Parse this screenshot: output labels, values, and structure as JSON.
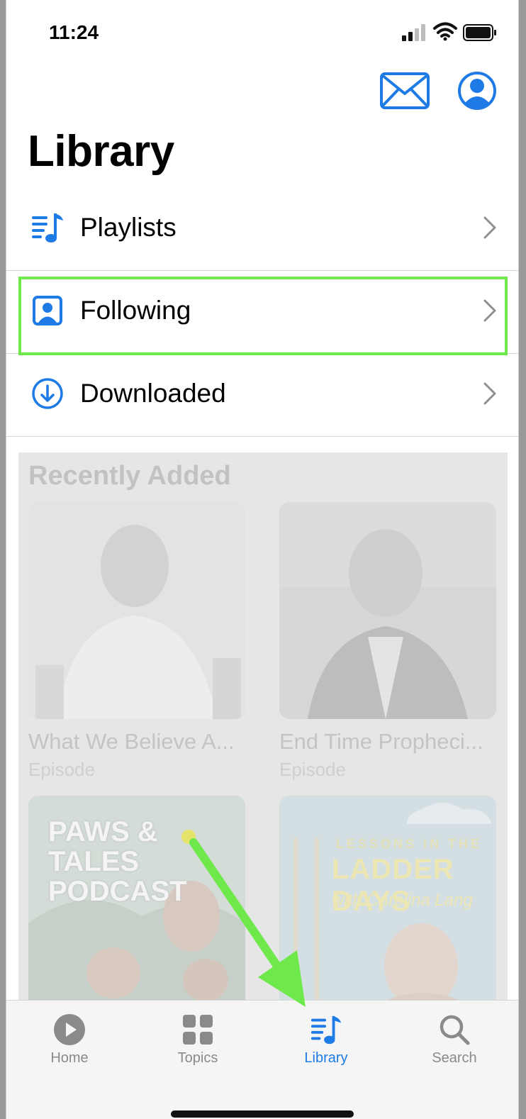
{
  "status_bar": {
    "time": "11:24"
  },
  "page": {
    "title": "Library"
  },
  "rows": [
    {
      "label": "Playlists",
      "icon": "playlist-icon"
    },
    {
      "label": "Following",
      "icon": "person-square-icon"
    },
    {
      "label": "Downloaded",
      "icon": "download-circle-icon"
    }
  ],
  "recent": {
    "title": "Recently Added",
    "items": [
      {
        "title": "What We Believe A...",
        "subtitle": "Episode"
      },
      {
        "title": "End Time Propheci...",
        "subtitle": "Episode"
      },
      {
        "art_text": "PAWS & TALES PODCAST"
      },
      {
        "art_text_1": "LESSONS IN THE",
        "art_text_2": "LADDER DAYS",
        "art_text_3": "with Carolina Lang"
      }
    ]
  },
  "tabs": [
    {
      "label": "Home",
      "icon": "play-circle-icon"
    },
    {
      "label": "Topics",
      "icon": "grid-icon"
    },
    {
      "label": "Library",
      "icon": "playlist-icon",
      "active": true
    },
    {
      "label": "Search",
      "icon": "magnifier-icon"
    }
  ],
  "colors": {
    "accent": "#1e7be6",
    "highlight": "#6ee84a",
    "arrow": "#6ee84a"
  }
}
